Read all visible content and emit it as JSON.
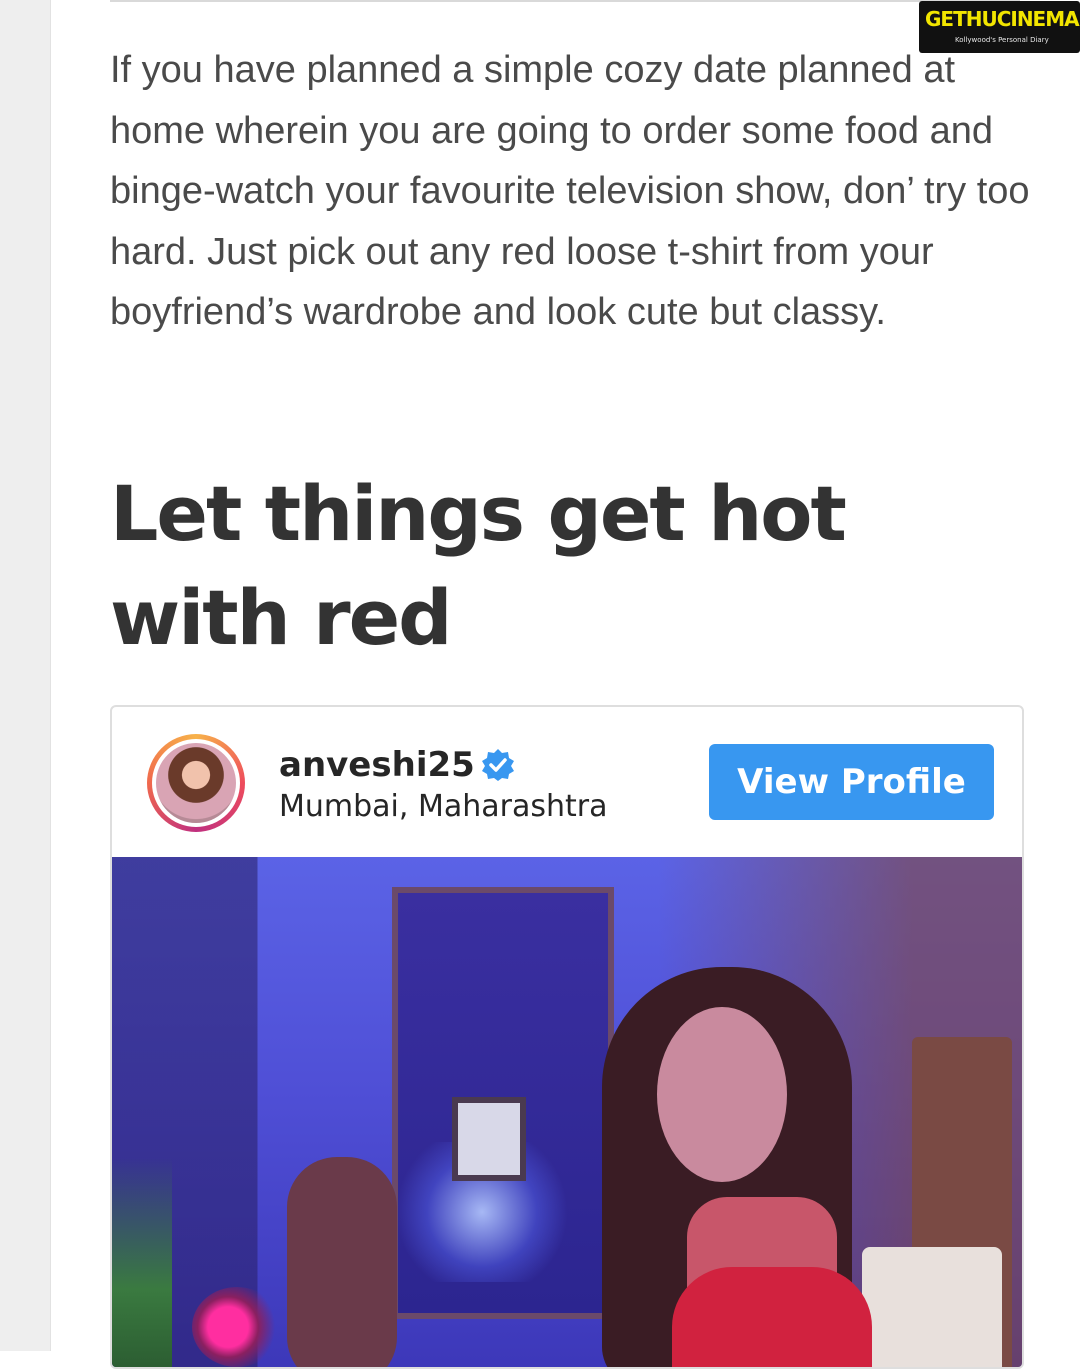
{
  "article": {
    "paragraph": "If you have planned a simple cozy date planned at home wherein you are going to order some food and binge-watch your favourite television show, don’ try too hard. Just pick out any red loose t-shirt from your boyfriend’s wardrobe and look cute but classy.",
    "heading": "Let things get hot with red"
  },
  "instagram_embed": {
    "username": "anveshi25",
    "verified": true,
    "location": "Mumbai, Maharashtra",
    "view_profile_label": "View Profile",
    "button_color": "#3897f0"
  },
  "watermark": {
    "brand": "GETHUCINEMA",
    "tagline": "Kollywood's Personal Diary"
  },
  "icons": {
    "verified": "verified-badge-icon"
  }
}
